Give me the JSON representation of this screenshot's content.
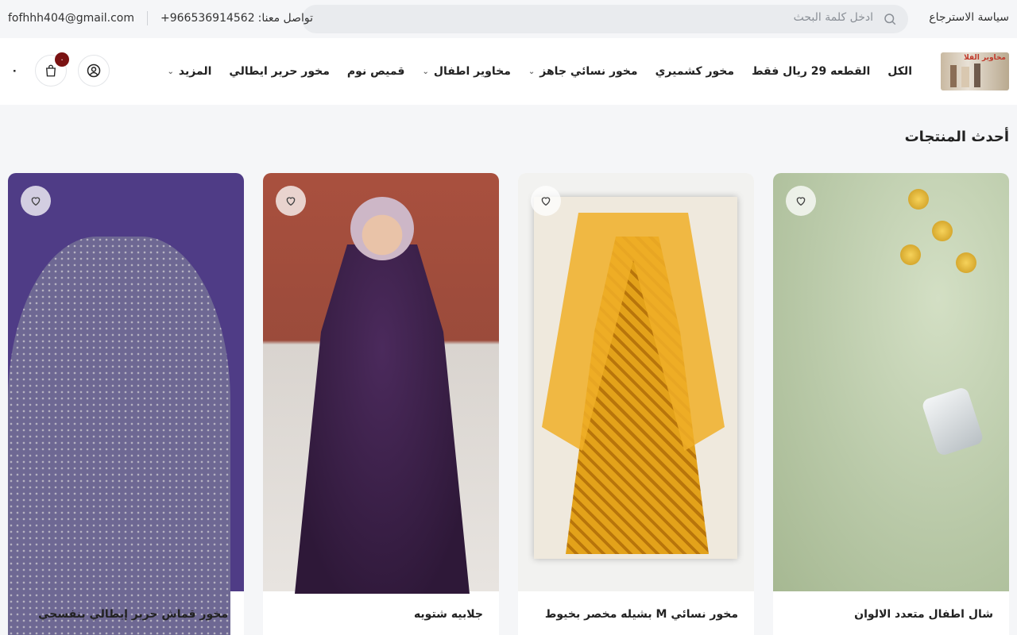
{
  "topbar": {
    "return_policy": "سياسة الاسترجاع",
    "search_placeholder": "ادخل كلمة البحث",
    "contact_label": "تواصل معنا:",
    "phone": "+966536914562",
    "email": "fofhhh404@gmail.com"
  },
  "header": {
    "logo_text": "مخاوير الفلا",
    "nav": [
      {
        "label": "الكل",
        "has_dropdown": false
      },
      {
        "label": "القطعه 29 ريال فقط",
        "has_dropdown": false
      },
      {
        "label": "مخور كشميري",
        "has_dropdown": false
      },
      {
        "label": "مخور نسائي جاهز",
        "has_dropdown": true
      },
      {
        "label": "مخاوير اطفال",
        "has_dropdown": true
      },
      {
        "label": "قميص نوم",
        "has_dropdown": false
      },
      {
        "label": "مخور حرير ايطالي",
        "has_dropdown": false
      },
      {
        "label": "المزيد",
        "has_dropdown": true
      }
    ],
    "cart_count": "٠",
    "cart_total": "٠"
  },
  "section": {
    "title": "أحدث المنتجات"
  },
  "products": [
    {
      "name": "شال اطفال متعدد الالوان"
    },
    {
      "name": "مخور نسائي M بشيله مخصر بخيوط"
    },
    {
      "name": "جلابيه شتويه"
    },
    {
      "name": "مخور قماش حرير إيطالي بنفسجي"
    }
  ],
  "colors": {
    "accent": "#7a1212",
    "background": "#f5f6f8"
  }
}
